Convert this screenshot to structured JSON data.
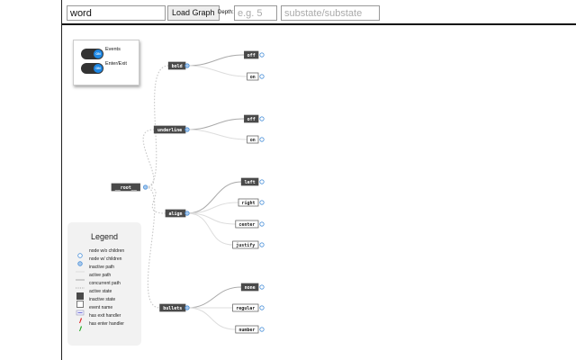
{
  "toolbar": {
    "query_value": "word",
    "load_label": "Load Graph",
    "depth_label": "Depth:",
    "depth_placeholder": "e.g. 5",
    "substate_placeholder": "substate/substate"
  },
  "toggles": [
    {
      "label": "Events",
      "state": "ON"
    },
    {
      "label": "Enter/Exit",
      "state": "ON"
    }
  ],
  "legend": {
    "title": "Legend",
    "items": [
      {
        "label": "node w/o children",
        "icon": "hollow-node-icon"
      },
      {
        "label": "node w/ children",
        "icon": "filled-node-icon"
      },
      {
        "label": "inactive path",
        "icon": "inactive-path-icon"
      },
      {
        "label": "active path",
        "icon": "active-path-icon"
      },
      {
        "label": "concurrent path",
        "icon": "concurrent-path-icon"
      },
      {
        "label": "active state",
        "icon": "active-state-icon"
      },
      {
        "label": "inactive state",
        "icon": "inactive-state-icon"
      },
      {
        "label": "event name",
        "icon": "event-name-icon"
      },
      {
        "label": "has exit handler",
        "icon": "exit-handler-icon"
      },
      {
        "label": "has enter handler",
        "icon": "enter-handler-icon"
      }
    ]
  },
  "graph": {
    "root": "__root__",
    "branches": [
      {
        "label": "bold",
        "active": true,
        "children": [
          {
            "label": "off",
            "active": true
          },
          {
            "label": "on",
            "active": false
          }
        ]
      },
      {
        "label": "underline",
        "active": true,
        "children": [
          {
            "label": "off",
            "active": true
          },
          {
            "label": "on",
            "active": false
          }
        ]
      },
      {
        "label": "align",
        "active": true,
        "children": [
          {
            "label": "left",
            "active": true
          },
          {
            "label": "right",
            "active": false
          },
          {
            "label": "center",
            "active": false
          },
          {
            "label": "justify",
            "active": false
          }
        ]
      },
      {
        "label": "bullets",
        "active": true,
        "children": [
          {
            "label": "none",
            "active": true
          },
          {
            "label": "regular",
            "active": false
          },
          {
            "label": "number",
            "active": false
          }
        ]
      }
    ]
  },
  "colors": {
    "active_state": "#4a4a4a",
    "node_blue": "#4a90d9",
    "inactive_path": "#cccccc",
    "active_path": "#aaaaaa"
  }
}
